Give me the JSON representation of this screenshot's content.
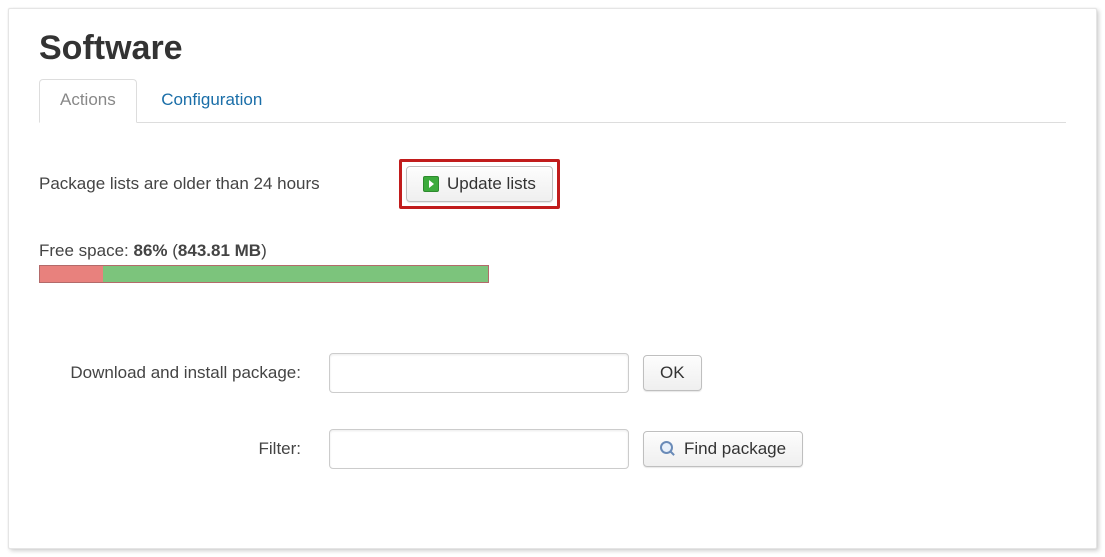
{
  "page_title": "Software",
  "tabs": {
    "actions": "Actions",
    "configuration": "Configuration"
  },
  "message": "Package lists are older than 24 hours",
  "update_button": "Update lists",
  "free_space": {
    "prefix": "Free space: ",
    "percent": "86%",
    "open": " (",
    "size": "843.81 MB",
    "close": ")",
    "used_width_pct": 14
  },
  "form": {
    "download_label": "Download and install package:",
    "ok_button": "OK",
    "filter_label": "Filter:",
    "find_button": "Find package"
  }
}
